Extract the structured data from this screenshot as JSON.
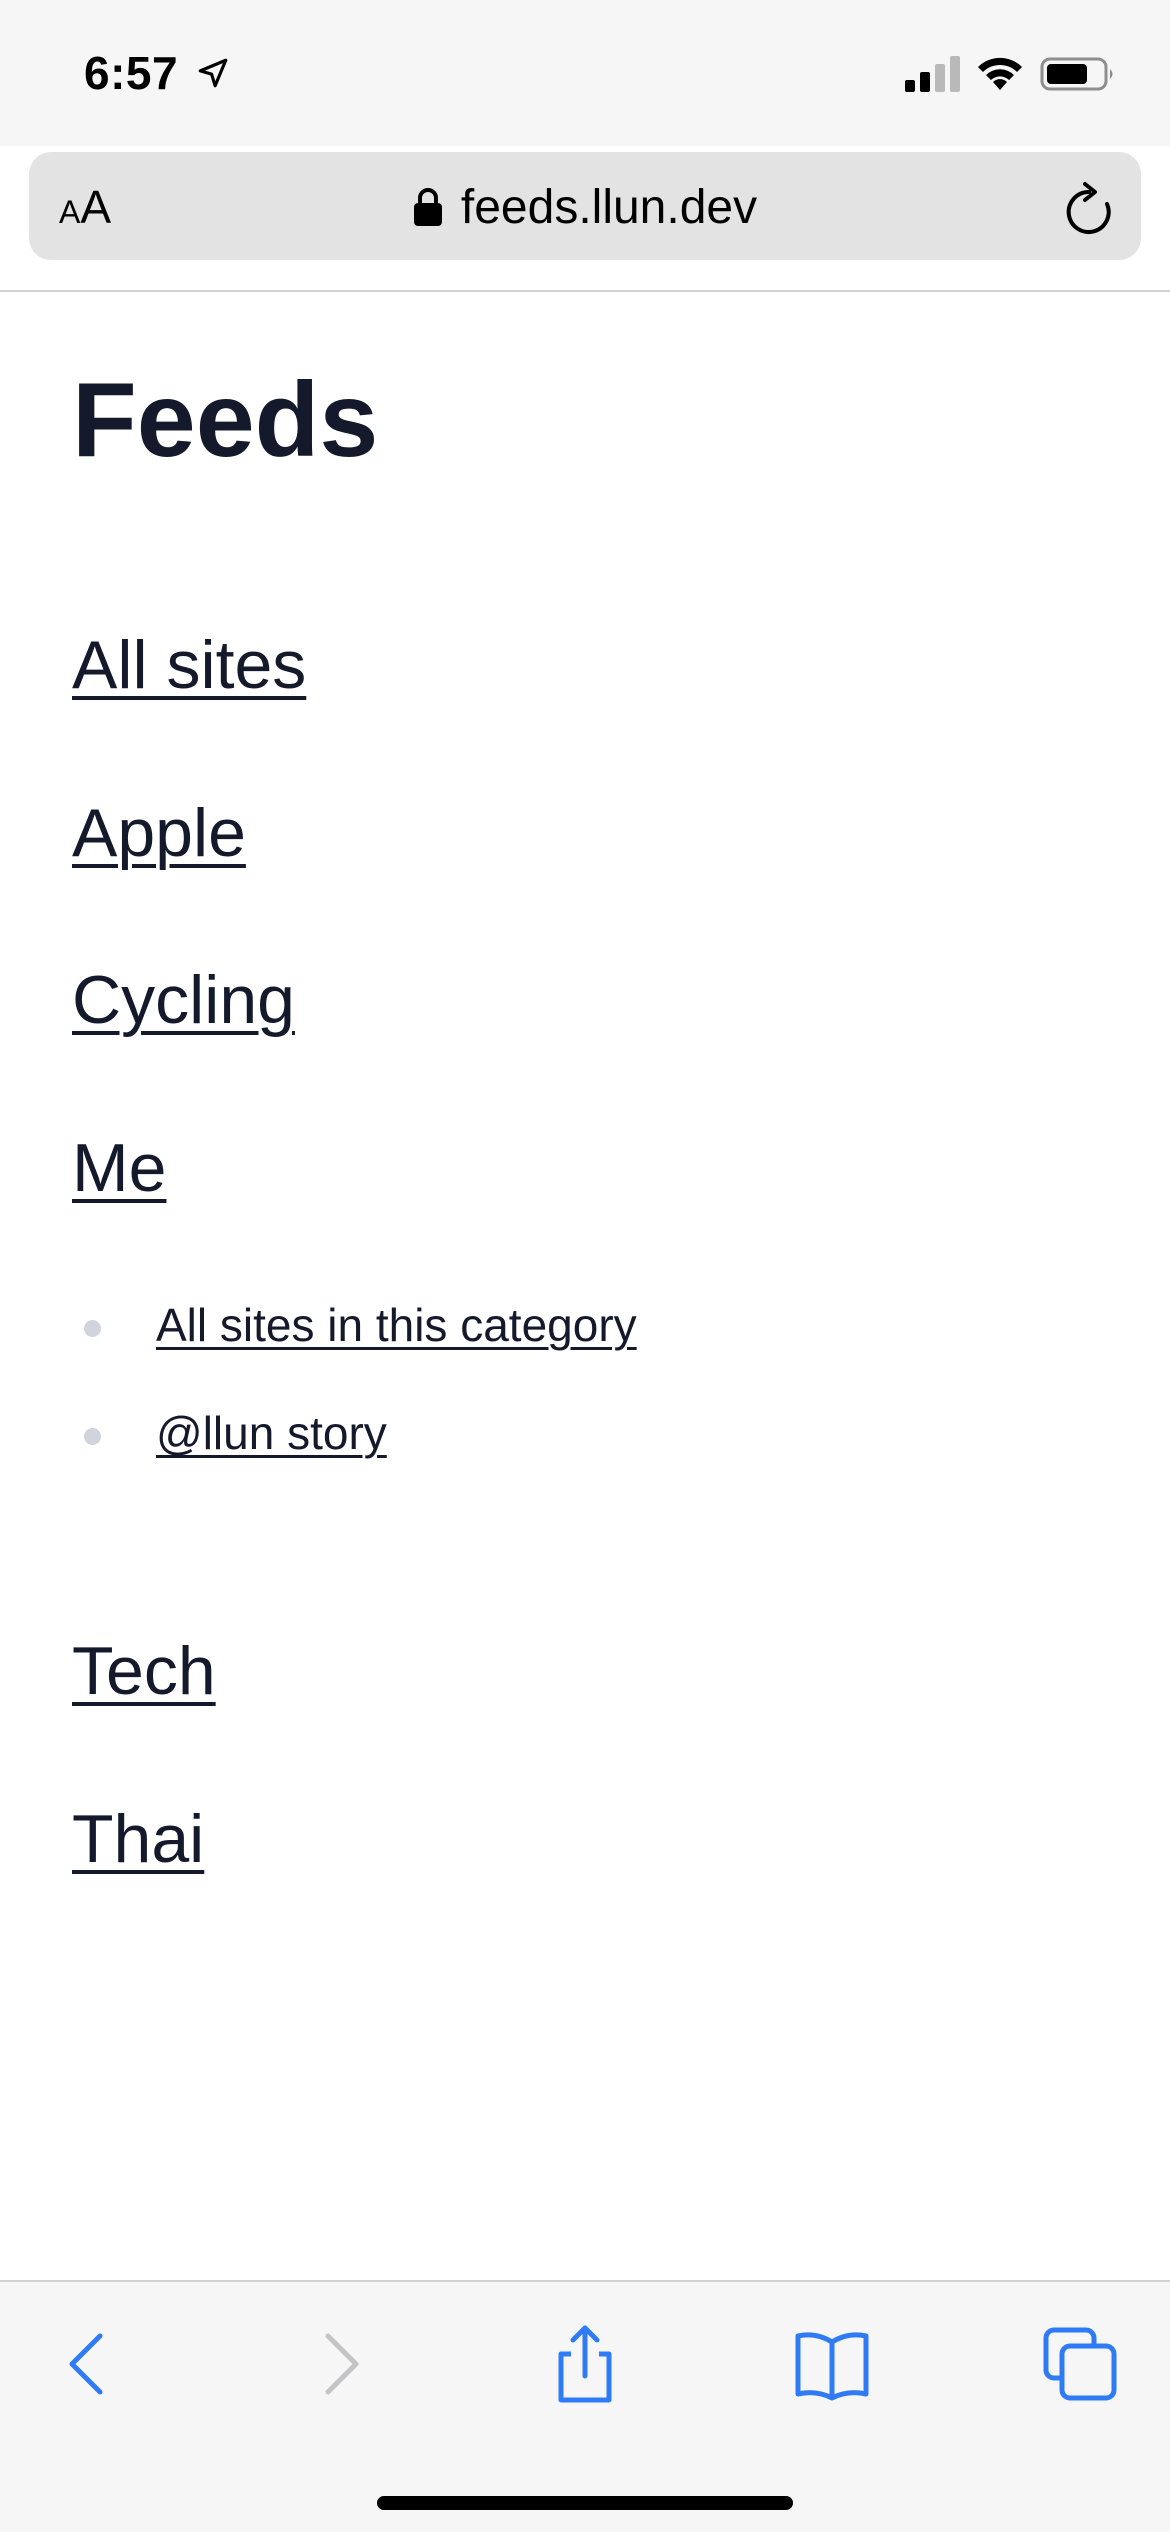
{
  "status_bar": {
    "time": "6:57"
  },
  "address_bar": {
    "text_size_small": "A",
    "text_size_large": "A",
    "url": "feeds.llun.dev"
  },
  "page": {
    "title": "Feeds",
    "categories": [
      {
        "label": "All sites"
      },
      {
        "label": "Apple"
      },
      {
        "label": "Cycling"
      },
      {
        "label": "Me"
      },
      {
        "label": "Tech"
      },
      {
        "label": "Thai"
      }
    ],
    "me_subitems": [
      {
        "label": "All sites in this category"
      },
      {
        "label": "@llun story"
      }
    ]
  },
  "colors": {
    "text": "#141a2b",
    "accent": "#2f7bf6",
    "disabled": "#c4c4c8",
    "bullet": "#d0d4dc"
  },
  "toolbar": {
    "icons": [
      "back-icon",
      "forward-icon",
      "share-icon",
      "bookmarks-icon",
      "tabs-icon"
    ]
  }
}
